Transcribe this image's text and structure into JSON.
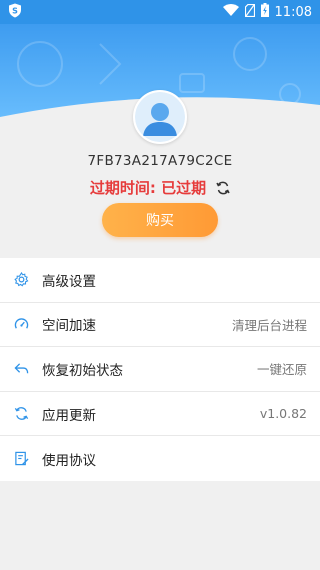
{
  "status_bar": {
    "app_icon": "shield-s-icon",
    "time": "11:08",
    "icons": [
      "wifi-icon",
      "no-sim-icon",
      "battery-charging-icon"
    ]
  },
  "profile": {
    "avatar": "user-avatar",
    "device_id": "7FB73A217A79C2CE",
    "expire_label": "过期时间: 已过期",
    "refresh_icon": "refresh-icon",
    "buy_button": "购买"
  },
  "menu": [
    {
      "icon": "gear-icon",
      "label": "高级设置",
      "value": ""
    },
    {
      "icon": "speedometer-icon",
      "label": "空间加速",
      "value": "清理后台进程"
    },
    {
      "icon": "restore-icon",
      "label": "恢复初始状态",
      "value": "一键还原"
    },
    {
      "icon": "update-icon",
      "label": "应用更新",
      "value": "v1.0.82"
    },
    {
      "icon": "document-edit-icon",
      "label": "使用协议",
      "value": ""
    }
  ],
  "colors": {
    "accent_blue": "#2f93e8",
    "expire_red": "#e63c3c",
    "buy_orange": "#ffa53f"
  }
}
